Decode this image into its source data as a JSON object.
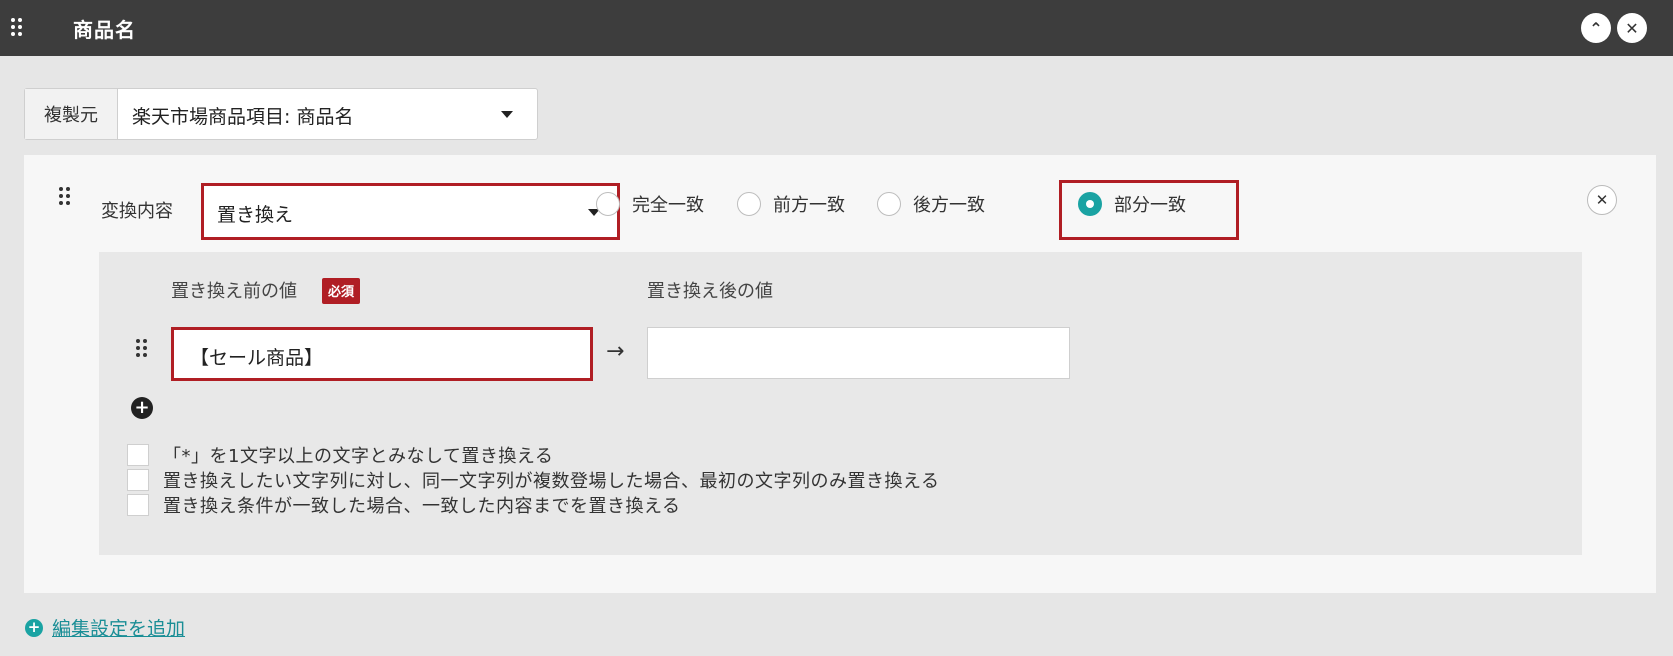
{
  "header": {
    "title": "商品名",
    "collapse_glyph": "⌃",
    "close_glyph": "✕"
  },
  "source": {
    "label": "複製元",
    "value": "楽天市場商品項目: 商品名"
  },
  "transform": {
    "label": "変換内容",
    "value": "置き換え",
    "match_options": [
      {
        "label": "完全一致",
        "checked": false
      },
      {
        "label": "前方一致",
        "checked": false
      },
      {
        "label": "後方一致",
        "checked": false
      },
      {
        "label": "部分一致",
        "checked": true
      }
    ],
    "accent_color": "#1aa3a3",
    "highlight_color": "#b01e24"
  },
  "replace": {
    "before_label": "置き換え前の値",
    "required_badge": "必須",
    "after_label": "置き換え後の値",
    "before_value": "【セール商品】",
    "after_value": "",
    "arrow_glyph": "→",
    "add_glyph": "+"
  },
  "options": [
    {
      "label": "「*」を1文字以上の文字とみなして置き換える",
      "checked": false
    },
    {
      "label": "置き換えしたい文字列に対し、同一文字列が複数登場した場合、最初の文字列のみ置き換える",
      "checked": false
    },
    {
      "label": "置き換え条件が一致した場合、一致した内容までを置き換える",
      "checked": false
    }
  ],
  "add_edit_link": {
    "label": "編集設定を追加",
    "plus_glyph": "+"
  },
  "icons": {
    "drag_handle": "drag-handle-icon",
    "caret": "chevron-down-icon",
    "close": "close-icon",
    "collapse": "chevron-up-icon",
    "arrow": "arrow-right-icon",
    "add": "plus-circle-icon"
  }
}
